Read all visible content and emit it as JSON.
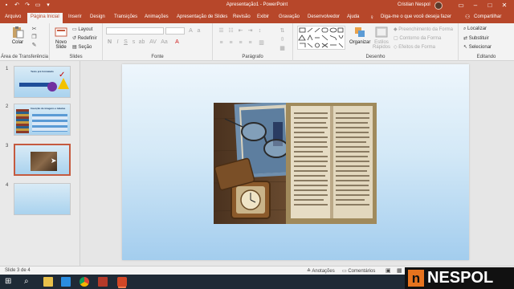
{
  "window": {
    "title": "Apresentação1 - PowerPoint",
    "user": "Cristian Nespol"
  },
  "tabs": [
    "Arquivo",
    "Página Inicial",
    "Inserir",
    "Design",
    "Transições",
    "Animações",
    "Apresentação de Slides",
    "Revisão",
    "Exibir",
    "Gravação",
    "Desenvolvedor",
    "Ajuda"
  ],
  "tellme": "Diga-me o que você deseja fazer",
  "share": "Compartilhar",
  "ribbon": {
    "clipboard": {
      "paste": "Colar",
      "group": "Área de Transferência"
    },
    "slides": {
      "new_slide": "Novo Slide",
      "layout": "Layout",
      "reset": "Redefinir",
      "section": "Seção",
      "group": "Slides"
    },
    "font": {
      "group": "Fonte"
    },
    "paragraph": {
      "group": "Parágrafo"
    },
    "drawing": {
      "arrange": "Organizar",
      "quick_styles": "Estilos Rápidos",
      "fill": "Preenchimento da Forma",
      "outline": "Contorno da Forma",
      "effects": "Efeitos de Forma",
      "group": "Desenho"
    },
    "editing": {
      "find": "Localizar",
      "replace": "Substituir",
      "select": "Selecionar",
      "group": "Editando"
    }
  },
  "slides": [
    {
      "num": "1",
      "title": "Texto pré formatado"
    },
    {
      "num": "2",
      "title": "Inserção de imagens e tabelas"
    },
    {
      "num": "3"
    },
    {
      "num": "4"
    }
  ],
  "status": {
    "slide": "Slide 3 de 4",
    "notes": "Anotações",
    "comments": "Comentários"
  },
  "brand": {
    "initial": "n",
    "name": "NESPOL"
  },
  "colors": {
    "accent": "#b7472a",
    "brand": "#e7731e"
  }
}
